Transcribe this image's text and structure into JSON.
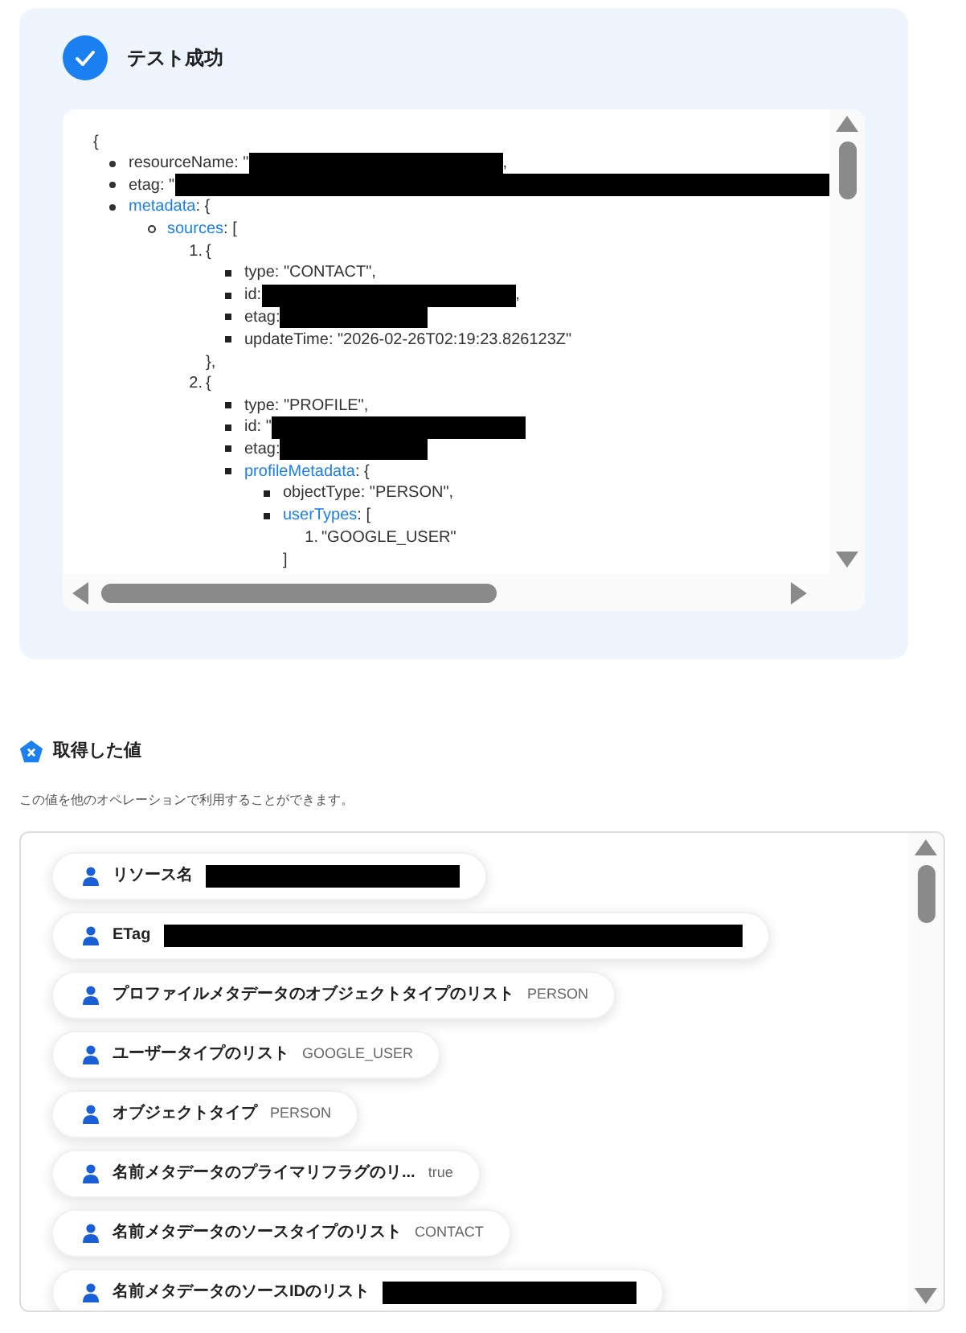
{
  "test_result": {
    "title": "テスト成功",
    "json_view": {
      "open": "{",
      "items": [
        {
          "kind": "disc",
          "key": "resourceName",
          "link": false,
          "text": ": \"",
          "redaction": {
            "kind": "short"
          },
          "tail": ","
        },
        {
          "kind": "disc",
          "key": "etag",
          "link": false,
          "text": ": \"",
          "redaction": {
            "kind": "full"
          }
        },
        {
          "kind": "disc",
          "key": "metadata",
          "link": true,
          "text": ": {",
          "children": [
            {
              "kind": "circle",
              "key": "sources",
              "link": true,
              "text": ": [",
              "children": [
                {
                  "ordinal": "1.",
                  "text": "{",
                  "close": "},",
                  "children": [
                    {
                      "kind": "square",
                      "key": "type",
                      "link": false,
                      "text": ": \"CONTACT\","
                    },
                    {
                      "kind": "square",
                      "key": "id",
                      "link": false,
                      "text": ":",
                      "redaction": {
                        "kind": "short"
                      },
                      "tail": ","
                    },
                    {
                      "kind": "square",
                      "key": "etag",
                      "link": false,
                      "text": ":",
                      "redaction": {
                        "kind": "medium"
                      }
                    },
                    {
                      "kind": "square",
                      "key": "updateTime",
                      "link": false,
                      "text": ": \"2026-02-26T02:19:23.826123Z\""
                    }
                  ]
                },
                {
                  "ordinal": "2.",
                  "text": "{",
                  "children": [
                    {
                      "kind": "square",
                      "key": "type",
                      "link": false,
                      "text": ": \"PROFILE\","
                    },
                    {
                      "kind": "square",
                      "key": "id",
                      "link": false,
                      "text": ": \"",
                      "redaction": {
                        "kind": "short"
                      }
                    },
                    {
                      "kind": "square",
                      "key": "etag",
                      "link": false,
                      "text": ":",
                      "redaction": {
                        "kind": "medium"
                      }
                    },
                    {
                      "kind": "square",
                      "key": "profileMetadata",
                      "link": true,
                      "text": ": {",
                      "children": [
                        {
                          "kind": "square",
                          "key": "objectType",
                          "link": false,
                          "text": ": \"PERSON\","
                        },
                        {
                          "kind": "square",
                          "key": "userTypes",
                          "link": true,
                          "text": ": [",
                          "close": "]",
                          "children": [
                            {
                              "ordinal": "1.",
                              "text": "\"GOOGLE_USER\""
                            }
                          ]
                        }
                      ]
                    }
                  ]
                }
              ]
            }
          ]
        }
      ]
    }
  },
  "output_values": {
    "title": "取得した値",
    "description": "この値を他のオペレーションで利用することができます。",
    "items": [
      {
        "label": "リソース名",
        "redaction": {
          "kind": "short"
        }
      },
      {
        "label": "ETag",
        "redaction": {
          "kind": "full"
        }
      },
      {
        "label": "プロファイルメタデータのオブジェクトタイプのリスト",
        "value": "PERSON"
      },
      {
        "label": "ユーザータイプのリスト",
        "value": "GOOGLE_USER"
      },
      {
        "label": "オブジェクトタイプ",
        "value": "PERSON"
      },
      {
        "label": "名前メタデータのプライマリフラグのリ...",
        "value": "true"
      },
      {
        "label": "名前メタデータのソースタイプのリスト",
        "value": "CONTACT"
      },
      {
        "label": "名前メタデータのソースIDのリスト",
        "redaction": {
          "kind": "short"
        }
      }
    ]
  }
}
